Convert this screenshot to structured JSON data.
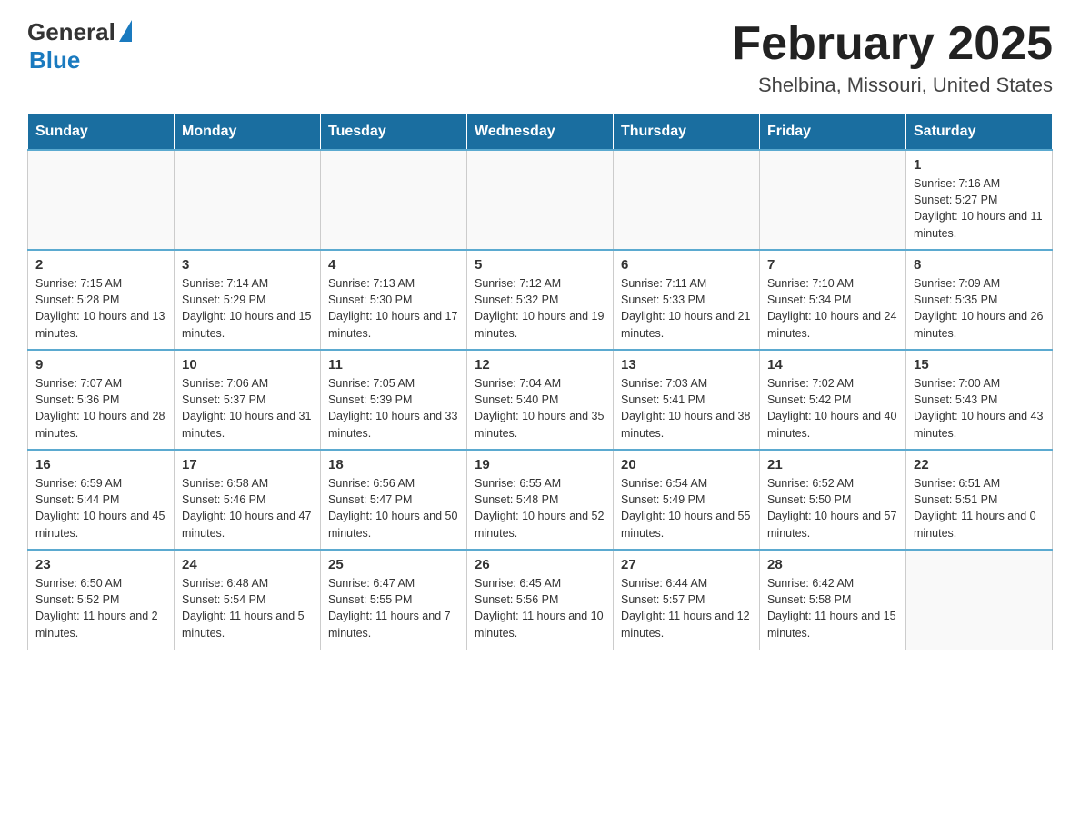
{
  "header": {
    "logo": {
      "general": "General",
      "blue": "Blue"
    },
    "title": "February 2025",
    "location": "Shelbina, Missouri, United States"
  },
  "days_of_week": [
    "Sunday",
    "Monday",
    "Tuesday",
    "Wednesday",
    "Thursday",
    "Friday",
    "Saturday"
  ],
  "weeks": [
    [
      {
        "day": "",
        "info": ""
      },
      {
        "day": "",
        "info": ""
      },
      {
        "day": "",
        "info": ""
      },
      {
        "day": "",
        "info": ""
      },
      {
        "day": "",
        "info": ""
      },
      {
        "day": "",
        "info": ""
      },
      {
        "day": "1",
        "info": "Sunrise: 7:16 AM\nSunset: 5:27 PM\nDaylight: 10 hours and 11 minutes."
      }
    ],
    [
      {
        "day": "2",
        "info": "Sunrise: 7:15 AM\nSunset: 5:28 PM\nDaylight: 10 hours and 13 minutes."
      },
      {
        "day": "3",
        "info": "Sunrise: 7:14 AM\nSunset: 5:29 PM\nDaylight: 10 hours and 15 minutes."
      },
      {
        "day": "4",
        "info": "Sunrise: 7:13 AM\nSunset: 5:30 PM\nDaylight: 10 hours and 17 minutes."
      },
      {
        "day": "5",
        "info": "Sunrise: 7:12 AM\nSunset: 5:32 PM\nDaylight: 10 hours and 19 minutes."
      },
      {
        "day": "6",
        "info": "Sunrise: 7:11 AM\nSunset: 5:33 PM\nDaylight: 10 hours and 21 minutes."
      },
      {
        "day": "7",
        "info": "Sunrise: 7:10 AM\nSunset: 5:34 PM\nDaylight: 10 hours and 24 minutes."
      },
      {
        "day": "8",
        "info": "Sunrise: 7:09 AM\nSunset: 5:35 PM\nDaylight: 10 hours and 26 minutes."
      }
    ],
    [
      {
        "day": "9",
        "info": "Sunrise: 7:07 AM\nSunset: 5:36 PM\nDaylight: 10 hours and 28 minutes."
      },
      {
        "day": "10",
        "info": "Sunrise: 7:06 AM\nSunset: 5:37 PM\nDaylight: 10 hours and 31 minutes."
      },
      {
        "day": "11",
        "info": "Sunrise: 7:05 AM\nSunset: 5:39 PM\nDaylight: 10 hours and 33 minutes."
      },
      {
        "day": "12",
        "info": "Sunrise: 7:04 AM\nSunset: 5:40 PM\nDaylight: 10 hours and 35 minutes."
      },
      {
        "day": "13",
        "info": "Sunrise: 7:03 AM\nSunset: 5:41 PM\nDaylight: 10 hours and 38 minutes."
      },
      {
        "day": "14",
        "info": "Sunrise: 7:02 AM\nSunset: 5:42 PM\nDaylight: 10 hours and 40 minutes."
      },
      {
        "day": "15",
        "info": "Sunrise: 7:00 AM\nSunset: 5:43 PM\nDaylight: 10 hours and 43 minutes."
      }
    ],
    [
      {
        "day": "16",
        "info": "Sunrise: 6:59 AM\nSunset: 5:44 PM\nDaylight: 10 hours and 45 minutes."
      },
      {
        "day": "17",
        "info": "Sunrise: 6:58 AM\nSunset: 5:46 PM\nDaylight: 10 hours and 47 minutes."
      },
      {
        "day": "18",
        "info": "Sunrise: 6:56 AM\nSunset: 5:47 PM\nDaylight: 10 hours and 50 minutes."
      },
      {
        "day": "19",
        "info": "Sunrise: 6:55 AM\nSunset: 5:48 PM\nDaylight: 10 hours and 52 minutes."
      },
      {
        "day": "20",
        "info": "Sunrise: 6:54 AM\nSunset: 5:49 PM\nDaylight: 10 hours and 55 minutes."
      },
      {
        "day": "21",
        "info": "Sunrise: 6:52 AM\nSunset: 5:50 PM\nDaylight: 10 hours and 57 minutes."
      },
      {
        "day": "22",
        "info": "Sunrise: 6:51 AM\nSunset: 5:51 PM\nDaylight: 11 hours and 0 minutes."
      }
    ],
    [
      {
        "day": "23",
        "info": "Sunrise: 6:50 AM\nSunset: 5:52 PM\nDaylight: 11 hours and 2 minutes."
      },
      {
        "day": "24",
        "info": "Sunrise: 6:48 AM\nSunset: 5:54 PM\nDaylight: 11 hours and 5 minutes."
      },
      {
        "day": "25",
        "info": "Sunrise: 6:47 AM\nSunset: 5:55 PM\nDaylight: 11 hours and 7 minutes."
      },
      {
        "day": "26",
        "info": "Sunrise: 6:45 AM\nSunset: 5:56 PM\nDaylight: 11 hours and 10 minutes."
      },
      {
        "day": "27",
        "info": "Sunrise: 6:44 AM\nSunset: 5:57 PM\nDaylight: 11 hours and 12 minutes."
      },
      {
        "day": "28",
        "info": "Sunrise: 6:42 AM\nSunset: 5:58 PM\nDaylight: 11 hours and 15 minutes."
      },
      {
        "day": "",
        "info": ""
      }
    ]
  ]
}
